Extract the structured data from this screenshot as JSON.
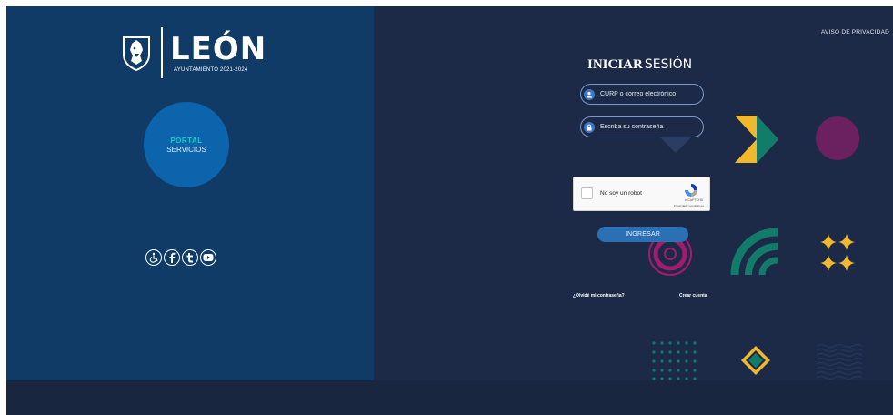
{
  "brand": {
    "name": "LEÓN",
    "subtitle": "AYUNTAMIENTO 2021-2024"
  },
  "portal": {
    "line1": "PORTAL",
    "line2": "SERVICIOS"
  },
  "social": [
    "accessibility-icon",
    "facebook-icon",
    "twitter-icon",
    "youtube-icon"
  ],
  "header": {
    "privacy": "AVISO DE PRIVACIDAD"
  },
  "login": {
    "title_bold": "INICIAR",
    "title_light": "SESIÓN",
    "user_placeholder": "CURP o correo electrónico",
    "password_placeholder": "Escriba su contraseña",
    "captcha_label": "No soy un robot",
    "captcha_brand": "reCAPTCHA",
    "captcha_links": "Privacidad · Condiciones",
    "submit": "INGRESAR",
    "forgot": "¿Olvidé mi contraseña?",
    "create": "Crear cuenta"
  },
  "colors": {
    "left_panel": "#0f3b66",
    "background": "#1c2a47",
    "portal_circle": "#0c64ad",
    "accent_teal": "#19c9c6",
    "accent_yellow": "#f2b82c",
    "accent_green": "#127c6a",
    "accent_purple": "#6b2160",
    "accent_magenta": "#a31b6f"
  }
}
